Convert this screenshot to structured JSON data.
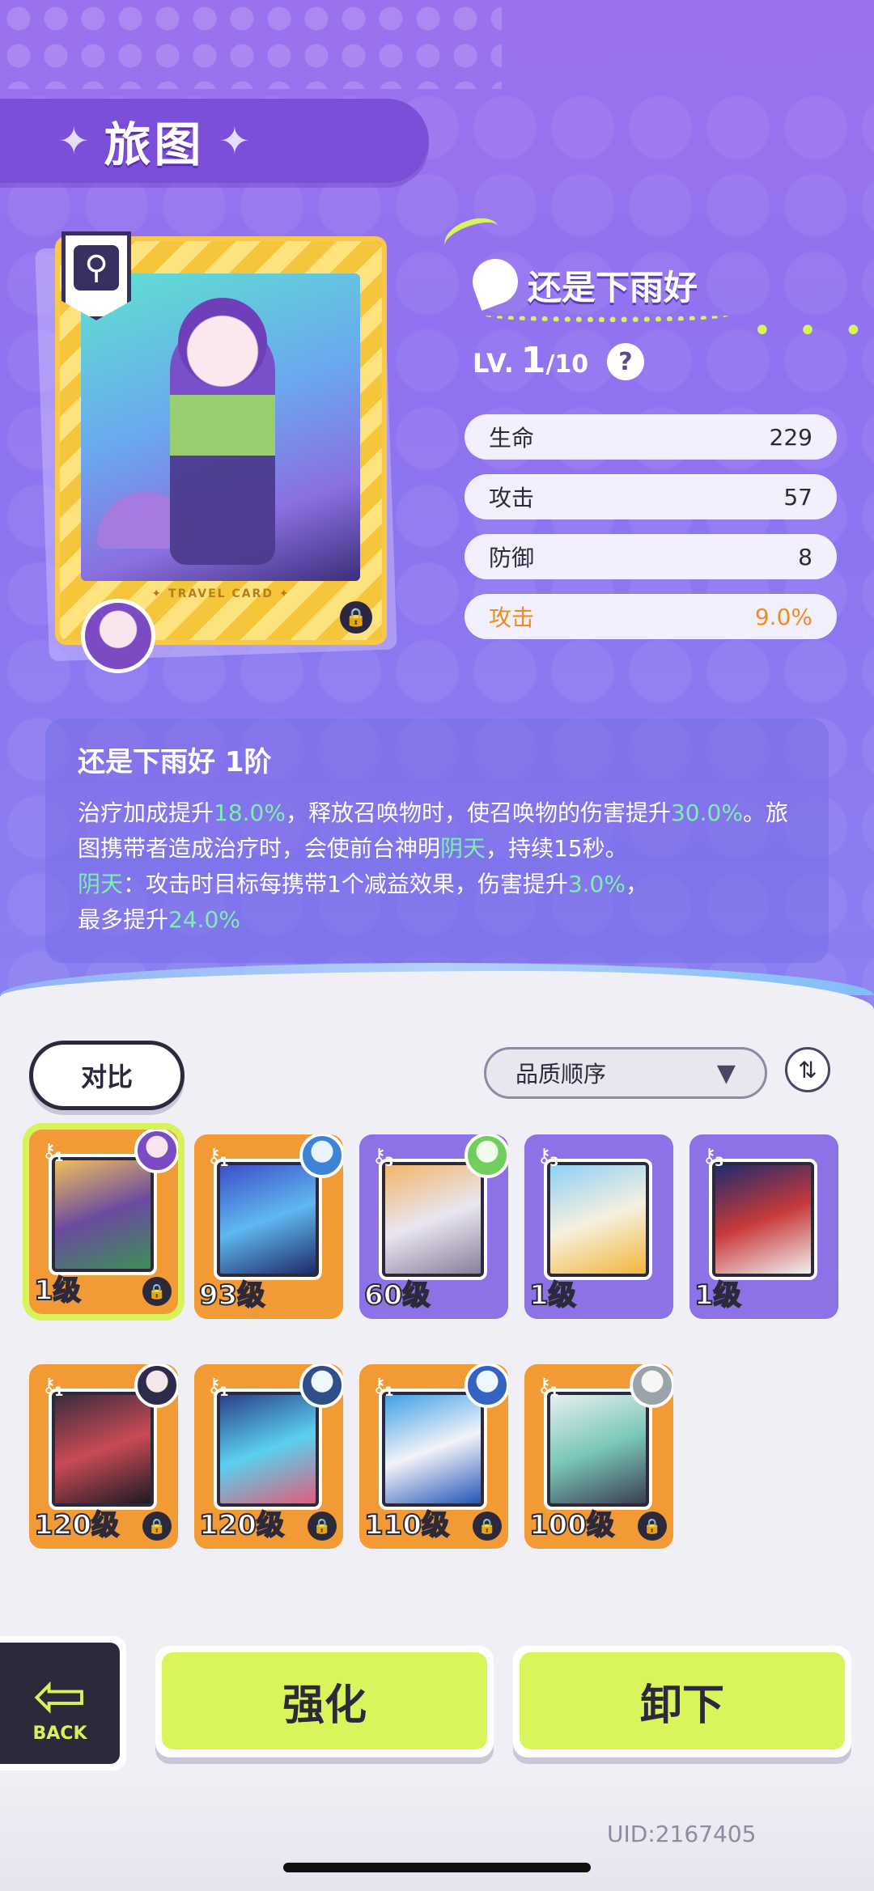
{
  "header": {
    "title": "旅图"
  },
  "card": {
    "card_label": "✦ TRAVEL CARD ✦",
    "name": "还是下雨好",
    "level_prefix": "LV.",
    "level_current": "1",
    "level_max": "/10"
  },
  "stats": [
    {
      "label": "生命",
      "value": "229"
    },
    {
      "label": "攻击",
      "value": "57"
    },
    {
      "label": "防御",
      "value": "8"
    },
    {
      "label": "攻击",
      "value": "9.0%"
    }
  ],
  "description": {
    "title": "还是下雨好 1阶",
    "p1_a": "治疗加成提升",
    "p1_b": "18.0%",
    "p1_c": "，释放召唤物时，使召唤物的伤害提升",
    "p1_d": "30.0%",
    "p1_e": "。旅图携带者造成治疗时，会使前台神明",
    "p1_f": "阴天",
    "p1_g": "，持续15秒。",
    "p2_a": "阴天",
    "p2_b": "：攻击时目标每携带1个减益效果，伤害提升",
    "p2_c": "3.0%",
    "p2_d": "，",
    "p2_e": "最多提升",
    "p2_f": "24.0%"
  },
  "controls": {
    "compare_label": "对比",
    "sort_label": "品质顺序",
    "sort_arrow": "▼",
    "order_icon": "⇅"
  },
  "inventory": [
    {
      "level": "1级",
      "tier": "1",
      "color": "orange"
    },
    {
      "level": "93级",
      "tier": "1",
      "color": "orange"
    },
    {
      "level": "60级",
      "tier": "3",
      "color": "purple"
    },
    {
      "level": "1级",
      "tier": "3",
      "color": "purple"
    },
    {
      "level": "1级",
      "tier": "3",
      "color": "purple"
    },
    {
      "level": "120级",
      "tier": "1",
      "color": "orange"
    },
    {
      "level": "120级",
      "tier": "1",
      "color": "orange"
    },
    {
      "level": "110级",
      "tier": "1",
      "color": "orange"
    },
    {
      "level": "100级",
      "tier": "1",
      "color": "orange"
    }
  ],
  "buttons": {
    "back": "BACK",
    "enhance": "强化",
    "unequip": "卸下"
  },
  "footer": {
    "uid": "UID:2167405"
  },
  "colors": {
    "accent_lime": "#d9f55c",
    "hero_purple": "#8f72f0",
    "highlight_green": "#7df0b0",
    "bonus_orange": "#f18d1c"
  }
}
